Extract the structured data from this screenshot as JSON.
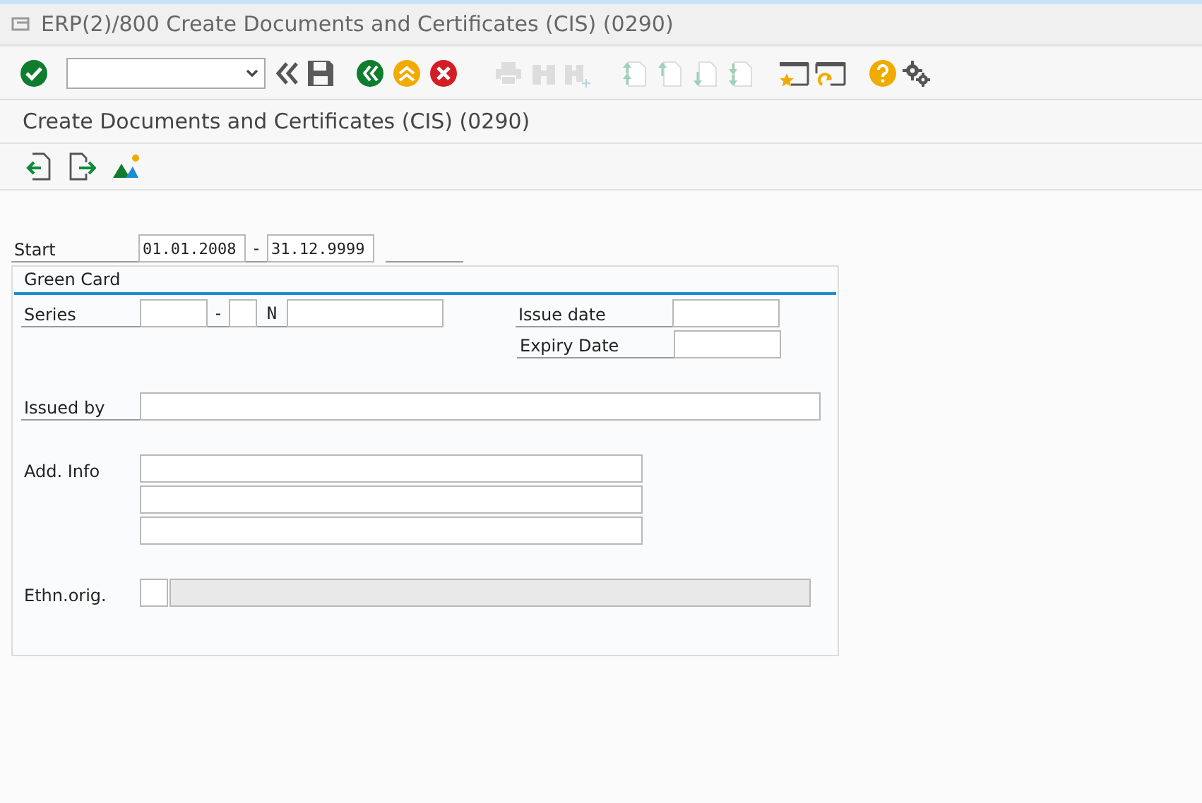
{
  "window": {
    "title": "ERP(2)/800 Create Documents and Certificates (CIS) (0290)"
  },
  "screen_title": "Create Documents and Certificates (CIS) (0290)",
  "period": {
    "label": "Start",
    "from": "01.01.2008",
    "separator": "-",
    "to": "31.12.9999"
  },
  "group": {
    "title": "Green Card",
    "series": {
      "label": "Series",
      "separator": "-",
      "number_prefix": "N"
    },
    "issue_date": {
      "label": "Issue date"
    },
    "expiry_date": {
      "label": "Expiry Date"
    },
    "issued_by": {
      "label": "Issued by"
    },
    "add_info": {
      "label": "Add. Info"
    },
    "ethnic_origin": {
      "label": "Ethn.orig.",
      "description_disabled": true
    }
  }
}
